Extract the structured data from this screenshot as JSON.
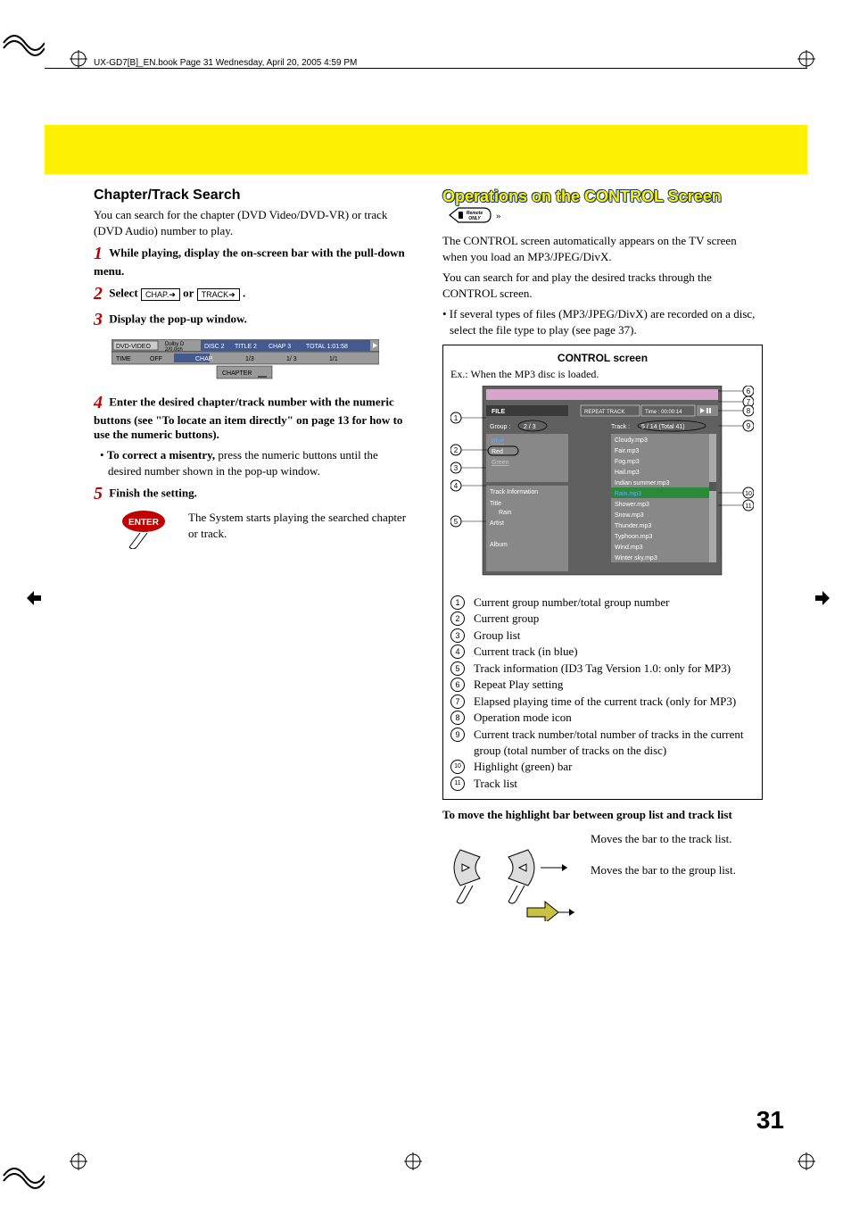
{
  "header": "UX-GD7[B]_EN.book  Page 31  Wednesday, April 20, 2005  4:59 PM",
  "page_number": "31",
  "left": {
    "heading": "Chapter/Track Search",
    "intro": "You can search for the chapter (DVD Video/DVD-VR) or track (DVD Audio) number to play.",
    "step1": "While playing, display the on-screen bar with the pull-down menu.",
    "step2_pre": "Select",
    "step2_box1": "CHAP.➜",
    "step2_or": "or",
    "step2_box2": "TRACK➜",
    "step2_post": ".",
    "step3": "Display the pop-up window.",
    "step4": "Enter the desired chapter/track number with the numeric buttons (see \"To locate an item directly\" on page 13 for how to use the numeric buttons).",
    "step4_bullet_bold": "To correct a misentry,",
    "step4_bullet_rest": " press the numeric buttons until the desired number shown in the pop-up window.",
    "step5": "Finish the setting.",
    "enter_label": "ENTER",
    "enter_text": "The System starts playing the searched chapter or track.",
    "osd": {
      "row1": [
        "DVD-VIDEO",
        "Dolby D",
        "2/0.0ch",
        "DISC 2",
        "TITLE  2",
        "CHAP  3",
        "TOTAL  1:01:58"
      ],
      "row2": [
        "TIME",
        "OFF",
        "CHAP.",
        "1/3",
        "1/ 3",
        "1/1"
      ],
      "row3": "CHAPTER"
    }
  },
  "right": {
    "heading": "Operations on the CONTROL Screen",
    "badge": "Remote ONLY",
    "p1": "The CONTROL screen automatically appears on the TV screen when you load an MP3/JPEG/DivX.",
    "p2": "You can search for and play the desired tracks through the CONTROL screen.",
    "p3": "• If several types of files (MP3/JPEG/DivX) are recorded on a disc, select the file type to play (see page 37).",
    "control": {
      "title": "CONTROL screen",
      "example": "Ex.: When the MP3 disc is loaded.",
      "file": "FILE",
      "repeat": "REPEAT TRACK",
      "time": "Time : 00:00:14",
      "group_label": "Group :",
      "group_val": "2 / 3",
      "track_label": "Track :",
      "track_val": "5 / 14 (Total 41)",
      "groups": [
        "Blue",
        "Red",
        "Green"
      ],
      "track_info": "Track Information",
      "ti_title_lbl": "Title",
      "ti_title_val": "Rain",
      "ti_artist_lbl": "Artist",
      "ti_album_lbl": "Album",
      "tracks": [
        "Cloudy.mp3",
        "Fair.mp3",
        "Fog.mp3",
        "Hail.mp3",
        "Indian summer.mp3",
        "Rain.mp3",
        "Shower.mp3",
        "Snow.mp3",
        "Thunder.mp3",
        "Typhoon.mp3",
        "Wind.mp3",
        "Winter sky.mp3"
      ]
    },
    "legend": [
      "Current group number/total group number",
      "Current group",
      "Group list",
      "Current track (in blue)",
      "Track information (ID3 Tag Version 1.0: only for MP3)",
      "Repeat Play setting",
      "Elapsed playing time of the current track (only for MP3)",
      "Operation mode icon",
      "Current track number/total number of tracks in the current group (total number of tracks on the disc)",
      "Highlight (green) bar",
      "Track list"
    ],
    "move_heading": "To move the highlight bar between group list and track list",
    "move1": "Moves the bar to the track list.",
    "move2": "Moves the bar to the group list."
  }
}
